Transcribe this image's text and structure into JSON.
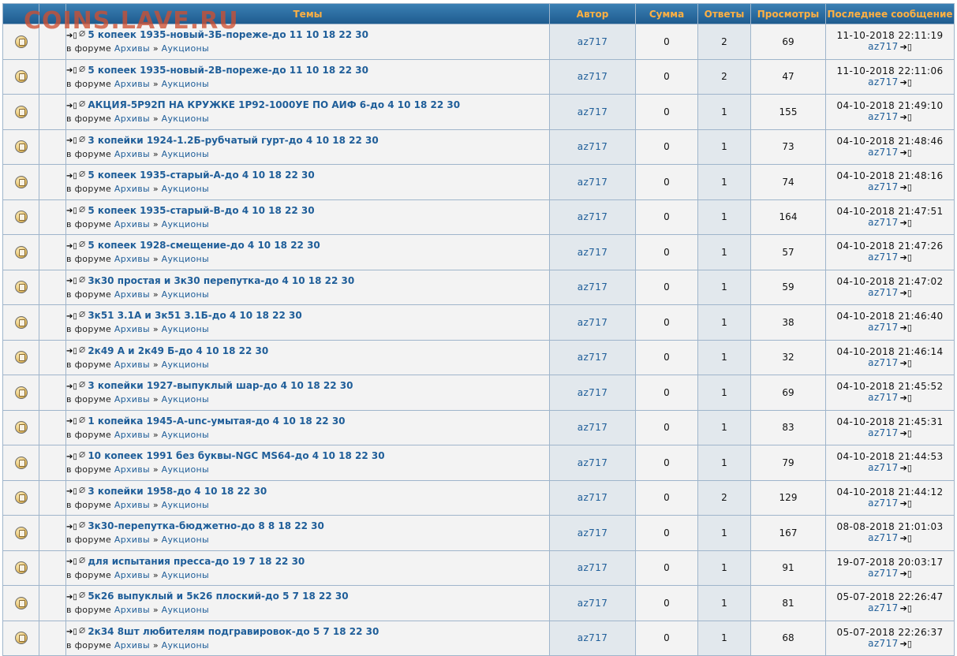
{
  "watermark": "COINS.LAVE.RU",
  "header": {
    "topics": "Темы",
    "author": "Автор",
    "sum": "Сумма",
    "replies": "Ответы",
    "views": "Просмотры",
    "last_post": "Последнее сообщение"
  },
  "forum_prefix": "в форуме",
  "forum_separator": "»",
  "rows": [
    {
      "title": "5 копеек 1935-новый-3Б-пореже-до 11 10 18 22 30",
      "forum": "Архивы",
      "subforum": "Аукционы",
      "author": "az717",
      "sum": "0",
      "replies": "2",
      "views": "69",
      "last_date": "11-10-2018 22:11:19",
      "last_user": "az717"
    },
    {
      "title": "5 копеек 1935-новый-2В-пореже-до 11 10 18 22 30",
      "forum": "Архивы",
      "subforum": "Аукционы",
      "author": "az717",
      "sum": "0",
      "replies": "2",
      "views": "47",
      "last_date": "11-10-2018 22:11:06",
      "last_user": "az717"
    },
    {
      "title": "АКЦИЯ-5Р92П НА КРУЖКЕ 1Р92-1000УЕ ПО АИФ 6-до 4 10 18 22 30",
      "forum": "Архивы",
      "subforum": "Аукционы",
      "author": "az717",
      "sum": "0",
      "replies": "1",
      "views": "155",
      "last_date": "04-10-2018 21:49:10",
      "last_user": "az717"
    },
    {
      "title": "3 копейки 1924-1.2Б-рубчатый гурт-до 4 10 18 22 30",
      "forum": "Архивы",
      "subforum": "Аукционы",
      "author": "az717",
      "sum": "0",
      "replies": "1",
      "views": "73",
      "last_date": "04-10-2018 21:48:46",
      "last_user": "az717"
    },
    {
      "title": "5 копеек 1935-старый-А-до 4 10 18 22 30",
      "forum": "Архивы",
      "subforum": "Аукционы",
      "author": "az717",
      "sum": "0",
      "replies": "1",
      "views": "74",
      "last_date": "04-10-2018 21:48:16",
      "last_user": "az717"
    },
    {
      "title": "5 копеек 1935-старый-В-до 4 10 18 22 30",
      "forum": "Архивы",
      "subforum": "Аукционы",
      "author": "az717",
      "sum": "0",
      "replies": "1",
      "views": "164",
      "last_date": "04-10-2018 21:47:51",
      "last_user": "az717"
    },
    {
      "title": "5 копеек 1928-смещение-до 4 10 18 22 30",
      "forum": "Архивы",
      "subforum": "Аукционы",
      "author": "az717",
      "sum": "0",
      "replies": "1",
      "views": "57",
      "last_date": "04-10-2018 21:47:26",
      "last_user": "az717"
    },
    {
      "title": "3к30 простая и 3к30 перепутка-до 4 10 18 22 30",
      "forum": "Архивы",
      "subforum": "Аукционы",
      "author": "az717",
      "sum": "0",
      "replies": "1",
      "views": "59",
      "last_date": "04-10-2018 21:47:02",
      "last_user": "az717"
    },
    {
      "title": "3к51 3.1А и 3к51 3.1Б-до 4 10 18 22 30",
      "forum": "Архивы",
      "subforum": "Аукционы",
      "author": "az717",
      "sum": "0",
      "replies": "1",
      "views": "38",
      "last_date": "04-10-2018 21:46:40",
      "last_user": "az717"
    },
    {
      "title": "2к49 А и 2к49 Б-до 4 10 18 22 30",
      "forum": "Архивы",
      "subforum": "Аукционы",
      "author": "az717",
      "sum": "0",
      "replies": "1",
      "views": "32",
      "last_date": "04-10-2018 21:46:14",
      "last_user": "az717"
    },
    {
      "title": "3 копейки 1927-выпуклый шар-до 4 10 18 22 30",
      "forum": "Архивы",
      "subforum": "Аукционы",
      "author": "az717",
      "sum": "0",
      "replies": "1",
      "views": "69",
      "last_date": "04-10-2018 21:45:52",
      "last_user": "az717"
    },
    {
      "title": "1 копейка 1945-А-unc-умытая-до 4 10 18 22 30",
      "forum": "Архивы",
      "subforum": "Аукционы",
      "author": "az717",
      "sum": "0",
      "replies": "1",
      "views": "83",
      "last_date": "04-10-2018 21:45:31",
      "last_user": "az717"
    },
    {
      "title": "10 копеек 1991 без буквы-NGC MS64-до 4 10 18 22 30",
      "forum": "Архивы",
      "subforum": "Аукционы",
      "author": "az717",
      "sum": "0",
      "replies": "1",
      "views": "79",
      "last_date": "04-10-2018 21:44:53",
      "last_user": "az717"
    },
    {
      "title": "3 копейки 1958-до 4 10 18 22 30",
      "forum": "Архивы",
      "subforum": "Аукционы",
      "author": "az717",
      "sum": "0",
      "replies": "2",
      "views": "129",
      "last_date": "04-10-2018 21:44:12",
      "last_user": "az717"
    },
    {
      "title": "3к30-перепутка-бюджетно-до 8 8 18 22 30",
      "forum": "Архивы",
      "subforum": "Аукционы",
      "author": "az717",
      "sum": "0",
      "replies": "1",
      "views": "167",
      "last_date": "08-08-2018 21:01:03",
      "last_user": "az717"
    },
    {
      "title": "для испытания пресса-до 19 7 18 22 30",
      "forum": "Архивы",
      "subforum": "Аукционы",
      "author": "az717",
      "sum": "0",
      "replies": "1",
      "views": "91",
      "last_date": "19-07-2018 20:03:17",
      "last_user": "az717"
    },
    {
      "title": "5к26 выпуклый и 5к26 плоский-до 5 7 18 22 30",
      "forum": "Архивы",
      "subforum": "Аукционы",
      "author": "az717",
      "sum": "0",
      "replies": "1",
      "views": "81",
      "last_date": "05-07-2018 22:26:47",
      "last_user": "az717"
    },
    {
      "title": "2к34 8шт любителям подгравировок-до 5 7 18 22 30",
      "forum": "Архивы",
      "subforum": "Аукционы",
      "author": "az717",
      "sum": "0",
      "replies": "1",
      "views": "68",
      "last_date": "05-07-2018 22:26:37",
      "last_user": "az717"
    }
  ]
}
